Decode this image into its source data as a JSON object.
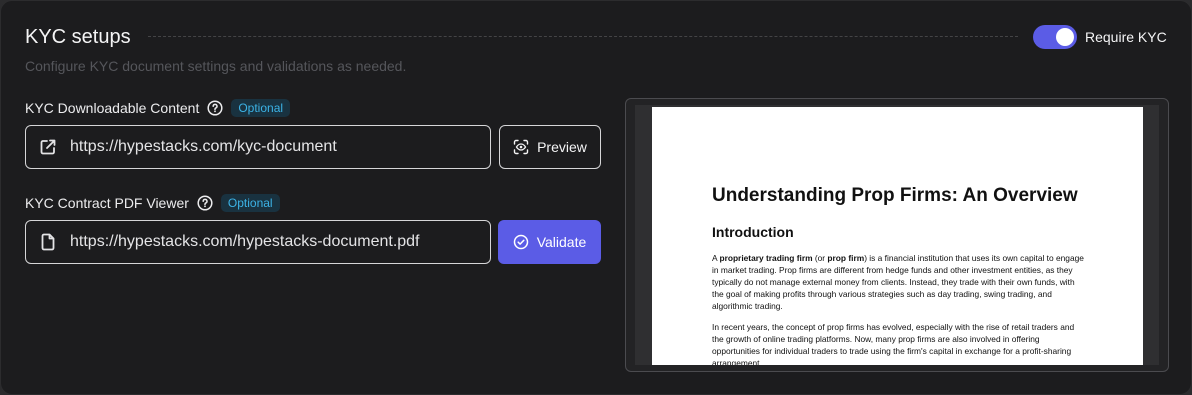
{
  "header": {
    "title": "KYC setups",
    "subtitle": "Configure KYC document settings and validations as needed.",
    "require_kyc_label": "Require KYC",
    "require_kyc_on": true
  },
  "downloadable": {
    "label": "KYC Downloadable Content",
    "badge": "Optional",
    "value": "https://hypestacks.com/kyc-document",
    "button": "Preview"
  },
  "contract": {
    "label": "KYC Contract PDF Viewer",
    "badge": "Optional",
    "value": "https://hypestacks.com/hypestacks-document.pdf",
    "button": "Validate"
  },
  "pdf": {
    "title": "Understanding Prop Firms: An Overview",
    "section": "Introduction",
    "p1_a": "A ",
    "p1_b1": "proprietary trading firm",
    "p1_c": " (or ",
    "p1_b2": "prop firm",
    "p1_d": ") is a financial institution that uses its own capital to engage in market trading. Prop firms are different from hedge funds and other investment entities, as they typically do not manage external money from clients. Instead, they trade with their own funds, with the goal of making profits through various strategies such as day trading, swing trading, and algorithmic trading.",
    "p2": "In recent years, the concept of prop firms has evolved, especially with the rise of retail traders and the growth of online trading platforms. Now, many prop firms are also involved in offering opportunities for individual traders to trade using the firm's capital in exchange for a profit-sharing arrangement."
  },
  "colors": {
    "accent": "#5b5ce6",
    "badge_text": "#3cb3e6",
    "badge_bg": "#193240"
  }
}
